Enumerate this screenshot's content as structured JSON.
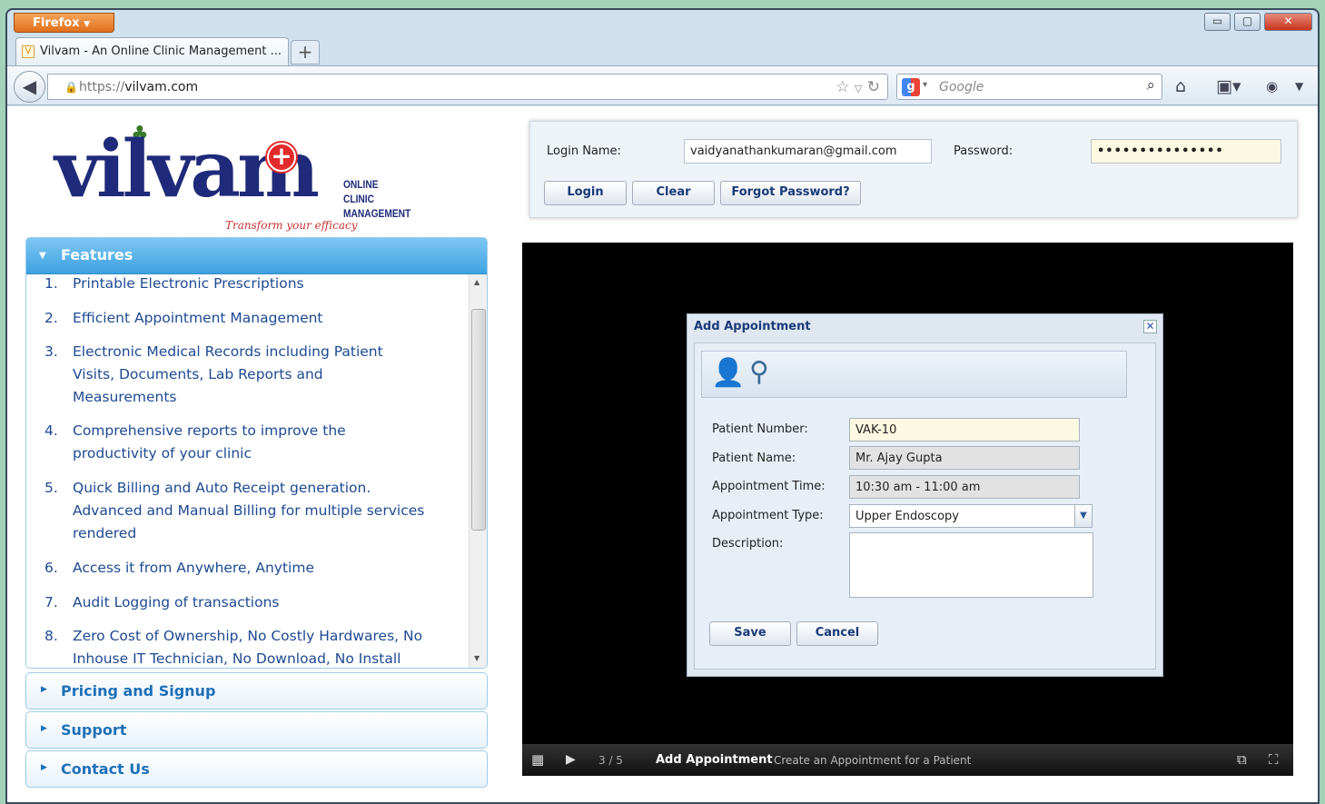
{
  "browser": {
    "menu_label": "Firefox",
    "tab_title": "Vilvam - An Online Clinic Management ...",
    "favicon_letter": "V",
    "new_tab_label": "+",
    "url_proto": "https://",
    "url_host": "vilvam.com",
    "search_placeholder": "Google"
  },
  "site": {
    "logo_text": "vilvam",
    "logo_sub_line1": "ONLINE CLINIC",
    "logo_sub_line2": "MANAGEMENT",
    "logo_tagline": "Transform your efficacy"
  },
  "login": {
    "name_label": "Login Name:",
    "name_value": "vaidyanathankumaran@gmail.com",
    "password_label": "Password:",
    "password_value": "•••••••••••••••",
    "login_button": "Login",
    "clear_button": "Clear",
    "forgot_button": "Forgot Password?"
  },
  "sidebar": {
    "features_title": "Features",
    "features": [
      {
        "num": "1.",
        "text": "Printable Electronic Prescriptions"
      },
      {
        "num": "2.",
        "text": "Efficient Appointment Management"
      },
      {
        "num": "3.",
        "text": "Electronic Medical Records including Patient Visits, Documents, Lab Reports and Measurements"
      },
      {
        "num": "4.",
        "text": "Comprehensive reports to improve the productivity of your clinic"
      },
      {
        "num": "5.",
        "text": "Quick Billing and Auto Receipt generation. Advanced and Manual Billing for multiple services rendered"
      },
      {
        "num": "6.",
        "text": "Access it from Anywhere, Anytime"
      },
      {
        "num": "7.",
        "text": "Audit Logging of transactions"
      },
      {
        "num": "8.",
        "text": "Zero Cost of Ownership, No Costly Hardwares, No Inhouse IT Technician, No Download, No Install"
      }
    ],
    "pricing_label": "Pricing and Signup",
    "support_label": "Support",
    "contact_label": "Contact Us"
  },
  "dialog": {
    "title": "Add Appointment",
    "patient_number_label": "Patient Number:",
    "patient_number_value": "VAK-10",
    "patient_name_label": "Patient Name:",
    "patient_name_value": "Mr.  Ajay Gupta",
    "appt_time_label": "Appointment Time:",
    "appt_time_value": "10:30 am - 11:00 am",
    "appt_type_label": "Appointment Type:",
    "appt_type_value": "Upper Endoscopy",
    "description_label": "Description:",
    "description_value": "",
    "save_button": "Save",
    "cancel_button": "Cancel"
  },
  "slideshow": {
    "counter": "3 / 5",
    "slide_title": "Add Appointment",
    "slide_caption": "Create an Appointment for a Patient"
  },
  "colors": {
    "accent_blue": "#3da2e2",
    "link_blue": "#1e4a92",
    "logo_navy": "#1f2a7a",
    "logo_red": "#e32a2a",
    "highlight_input": "#fdf8e1"
  }
}
